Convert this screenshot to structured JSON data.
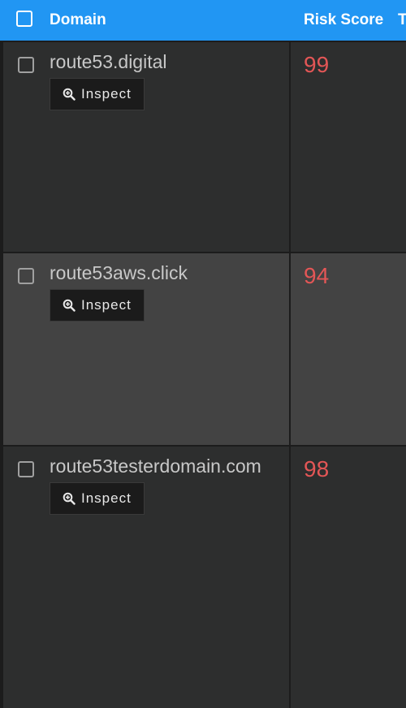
{
  "header": {
    "domain_label": "Domain",
    "risk_label": "Risk Score",
    "next_label": "T"
  },
  "rows": [
    {
      "domain": "route53.digital",
      "inspect_label": "Inspect",
      "risk_score": "99"
    },
    {
      "domain": "route53aws.click",
      "inspect_label": "Inspect",
      "risk_score": "94"
    },
    {
      "domain": "route53testerdomain.com",
      "inspect_label": "Inspect",
      "risk_score": "98"
    }
  ],
  "colors": {
    "header_bg": "#2196f3",
    "row_dark": "#2d2e2e",
    "row_highlight": "#434343",
    "risk_score": "#e35656"
  },
  "icons": {
    "inspect": "zoom-in-icon"
  }
}
